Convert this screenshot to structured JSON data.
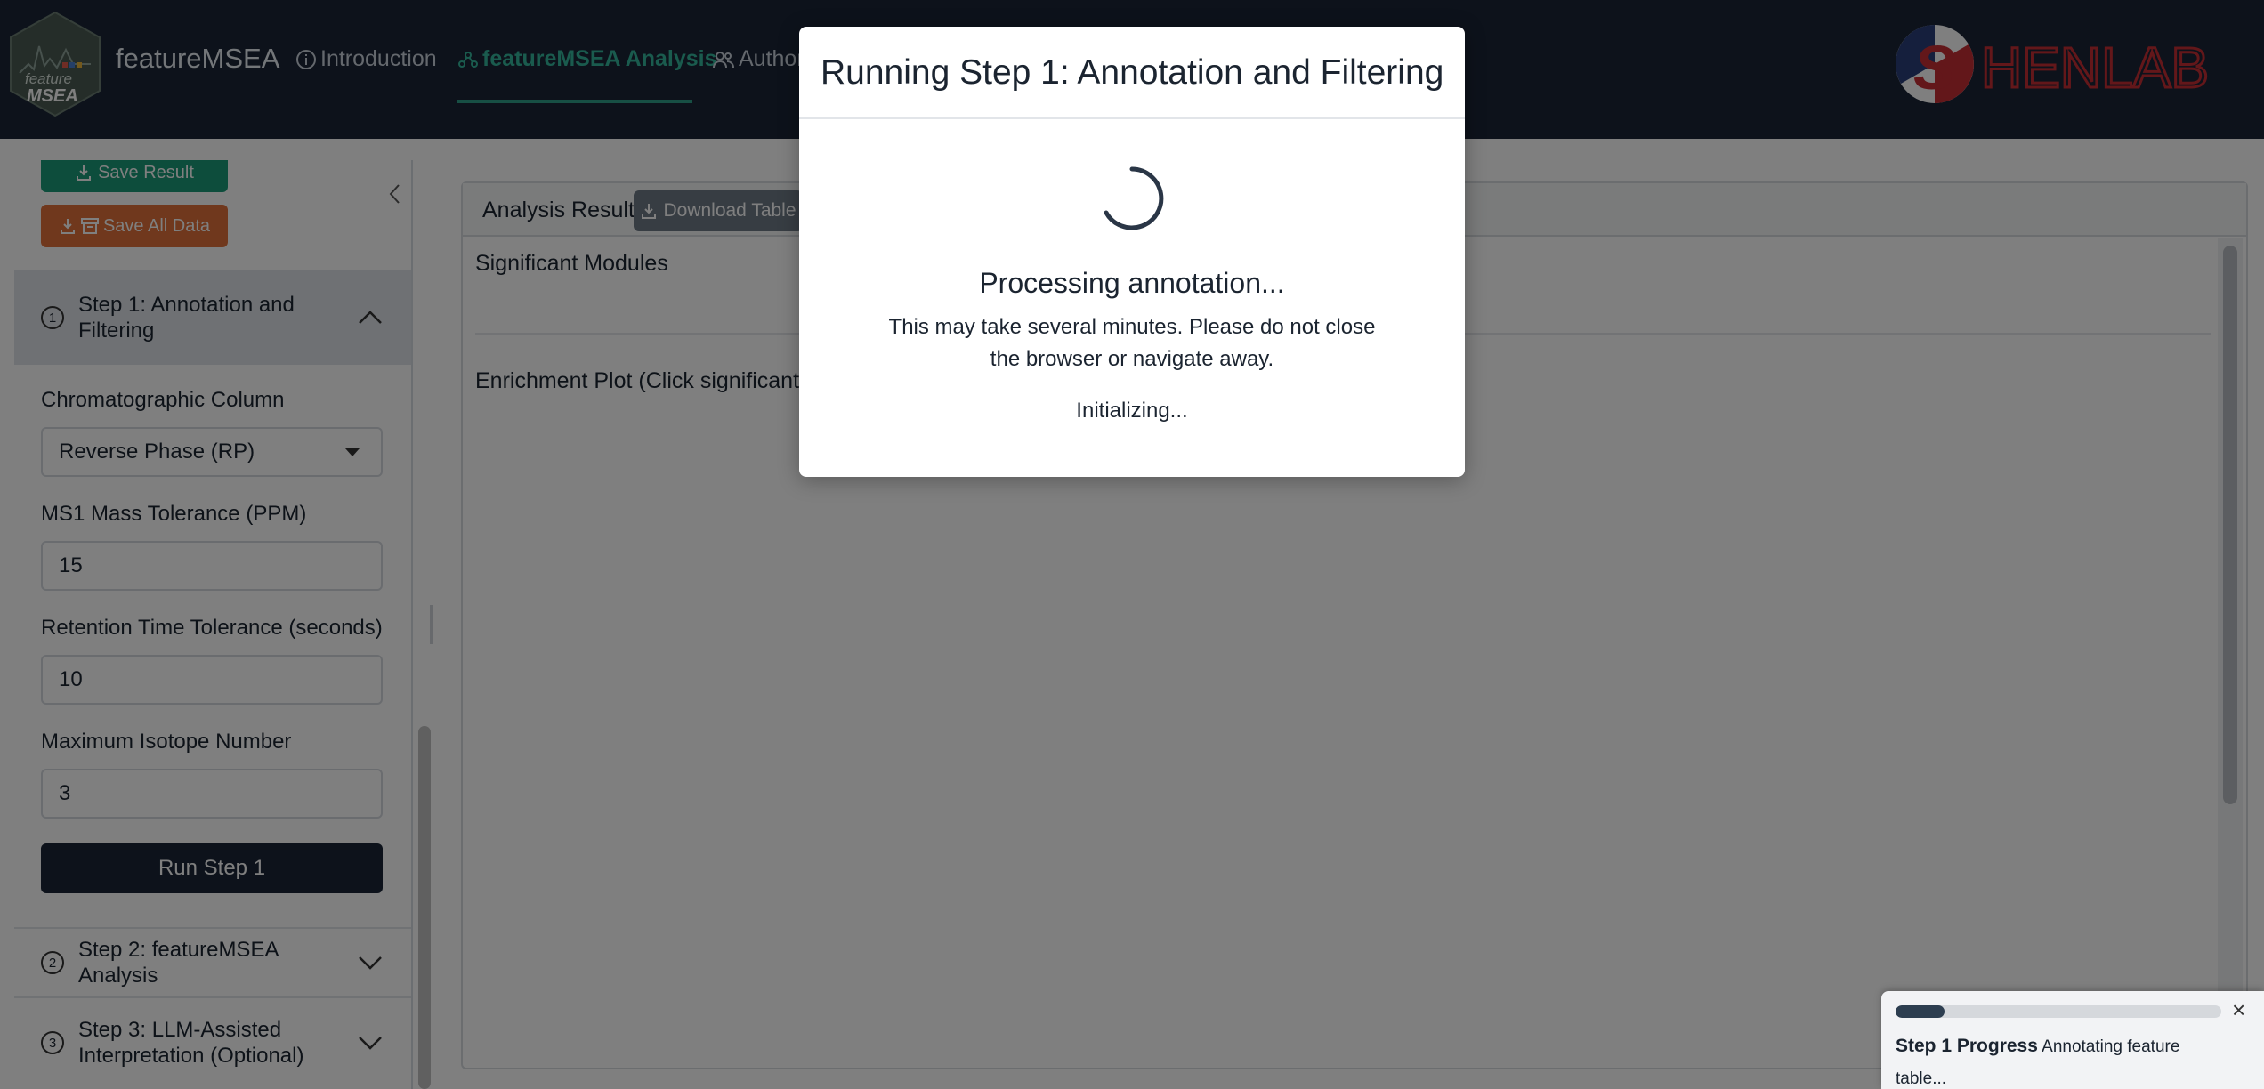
{
  "navbar": {
    "brand": "featureMSEA",
    "logo_text_1": "feature",
    "logo_text_2": "MSEA",
    "items": [
      {
        "label": "Introduction",
        "icon": "info-circle-icon"
      },
      {
        "label": "featureMSEA Analysis",
        "icon": "network-icon"
      },
      {
        "label": "Author",
        "icon": "people-icon"
      }
    ],
    "active_index": 1,
    "partner_logo": "SHENLAB",
    "colors": {
      "bg": "#1a2536",
      "active": "#35b79c"
    }
  },
  "sidebar": {
    "save_result_label": "Save Result",
    "save_all_label": "Save All Data",
    "steps": [
      {
        "num": "1",
        "label": "Step 1: Annotation and Filtering",
        "expanded": true
      },
      {
        "num": "2",
        "label": "Step 2: featureMSEA Analysis",
        "expanded": false
      },
      {
        "num": "3",
        "label": "Step 3: LLM-Assisted Interpretation (Optional)",
        "expanded": false
      }
    ],
    "fields": {
      "column_label": "Chromatographic Column",
      "column_value": "Reverse Phase (RP)",
      "ms1_label": "MS1 Mass Tolerance (PPM)",
      "ms1_value": "15",
      "rt_label": "Retention Time Tolerance (seconds)",
      "rt_value": "10",
      "isotope_label": "Maximum Isotope Number",
      "isotope_value": "3"
    },
    "run_label": "Run Step 1"
  },
  "main": {
    "card_title": "Analysis Results",
    "download_label": "Download Table",
    "significant_label": "Significant Modules",
    "plot_label": "Enrichment Plot (Click significant m"
  },
  "modal": {
    "title": "Running Step 1: Annotation and Filtering",
    "processing": "Processing annotation...",
    "message": "This may take several minutes. Please do not close the browser or navigate away.",
    "status": "Initializing..."
  },
  "toast": {
    "title": "Step 1 Progress",
    "text": "Annotating feature table...",
    "progress": 0.15,
    "close_glyph": "×"
  }
}
